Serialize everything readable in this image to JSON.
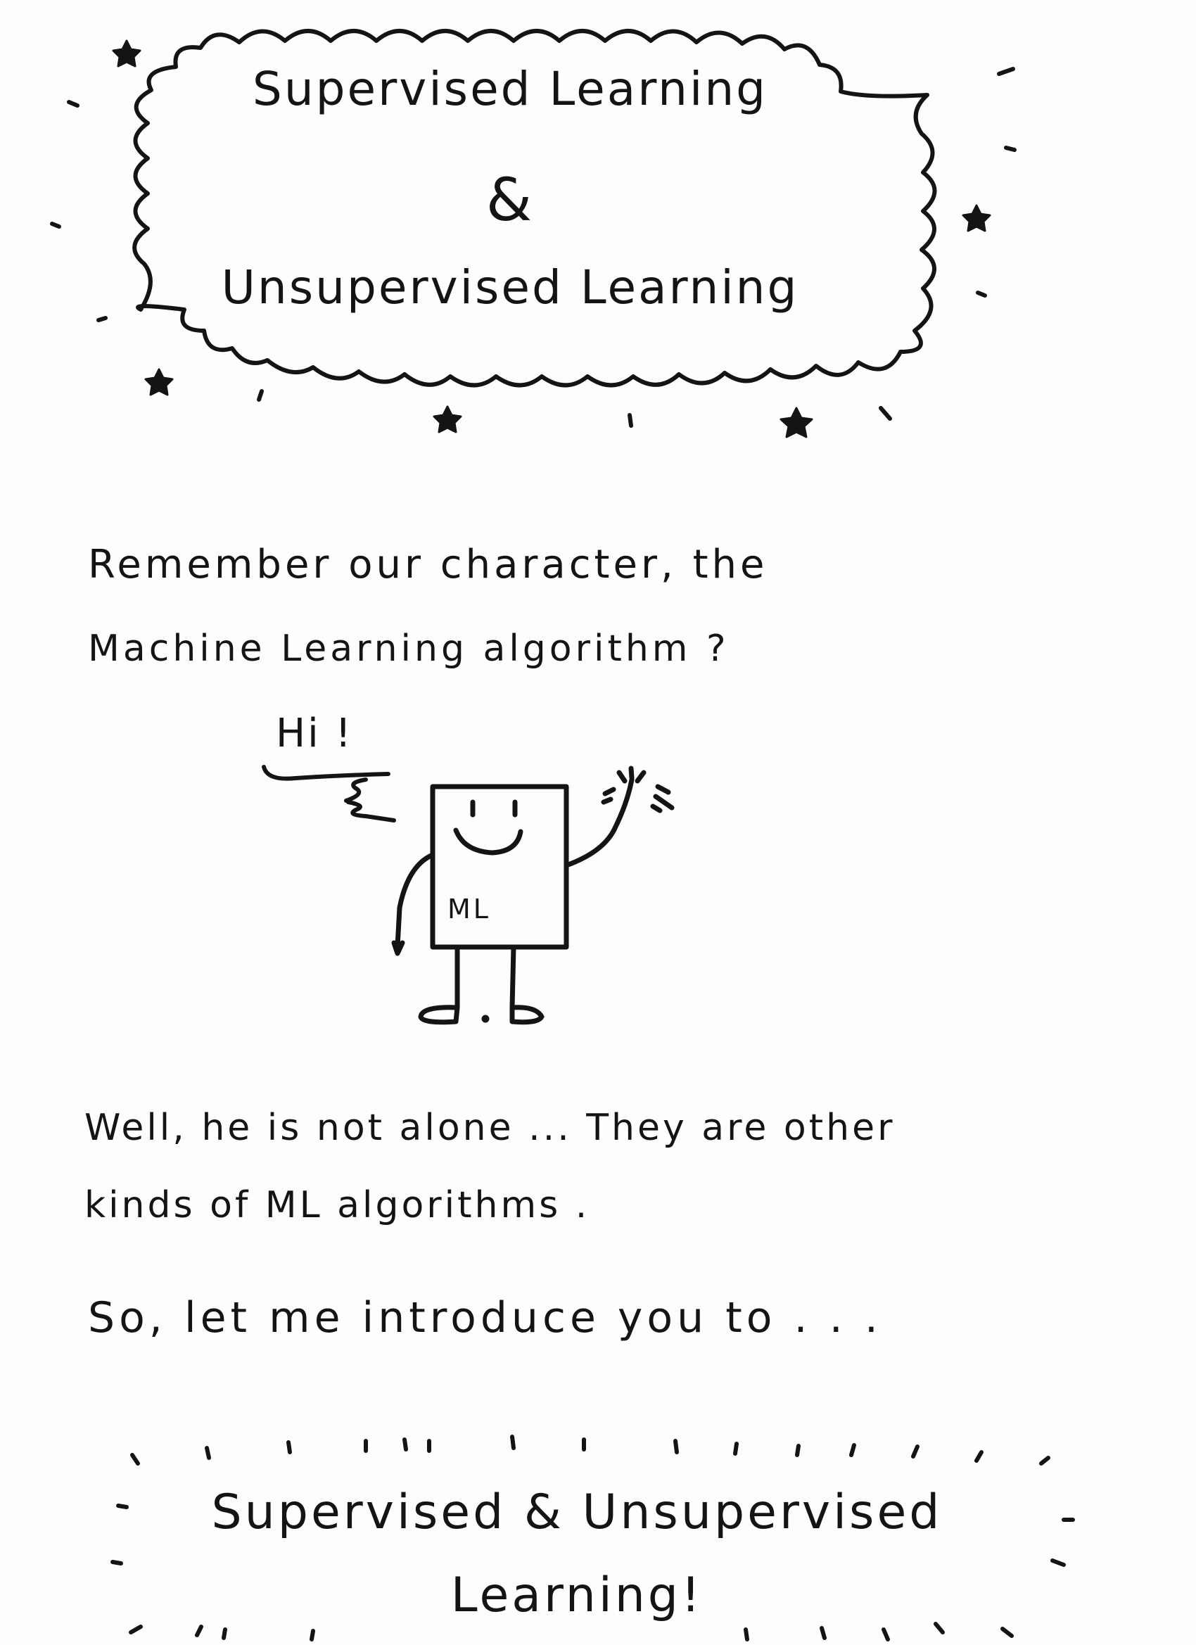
{
  "title_banner": {
    "line1": "Supervised Learning",
    "line2": "&",
    "line3": "Unsupervised Learning"
  },
  "intro": {
    "line1": "Remember our character, the",
    "line2": "Machine Learning algorithm ?"
  },
  "character": {
    "greeting": "Hi !",
    "label": "ML"
  },
  "paragraph": {
    "line1": "Well, he is not alone ... They are other",
    "line2": "kinds of ML algorithms ."
  },
  "lead_in": "So, let me introduce you to . . .",
  "closing_banner": {
    "line1": "Supervised & Unsupervised",
    "line2": "Learning!"
  },
  "colors": {
    "ink": "#141414",
    "paper": "#fdfdfc"
  }
}
